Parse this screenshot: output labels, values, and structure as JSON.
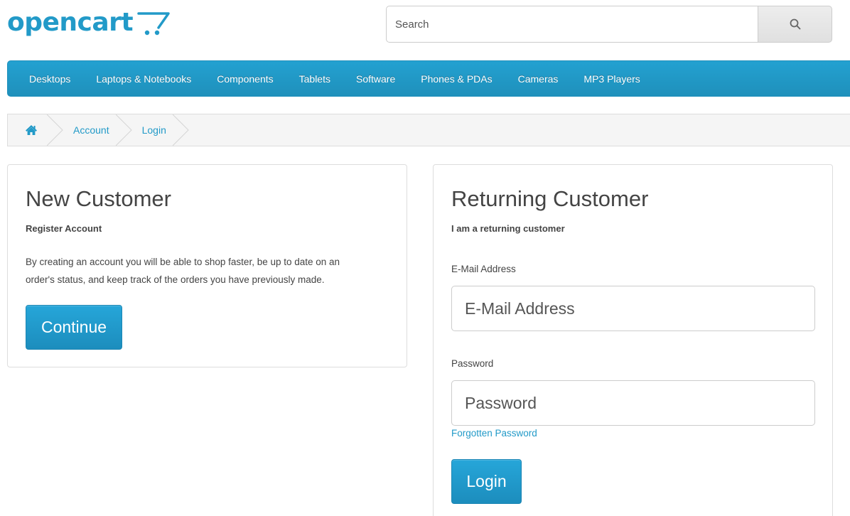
{
  "header": {
    "logo_text": "opencart",
    "search": {
      "placeholder": "Search"
    }
  },
  "menu": {
    "items": [
      "Desktops",
      "Laptops & Notebooks",
      "Components",
      "Tablets",
      "Software",
      "Phones & PDAs",
      "Cameras",
      "MP3 Players"
    ]
  },
  "breadcrumb": {
    "items": [
      "Account",
      "Login"
    ]
  },
  "new_customer": {
    "title": "New Customer",
    "subtitle": "Register Account",
    "description_line1": "By creating an account you will be able to shop faster, be up to date on an",
    "description_line2": "order's status, and keep track of the orders you have previously made.",
    "continue_label": "Continue"
  },
  "returning_customer": {
    "title": "Returning Customer",
    "subtitle": "I am a returning customer",
    "email_label": "E-Mail Address",
    "email_placeholder": "E-Mail Address",
    "password_label": "Password",
    "password_placeholder": "Password",
    "forgotten_password": "Forgotten Password",
    "login_label": "Login"
  },
  "colors": {
    "brand": "#229ac8",
    "menu_bg": "#229ac8",
    "button_bg": "#229ac8",
    "breadcrumb_bg": "#f5f5f5"
  },
  "icons": {
    "search": "search-icon",
    "home": "home-icon",
    "logo_cart": "cart-icon"
  }
}
